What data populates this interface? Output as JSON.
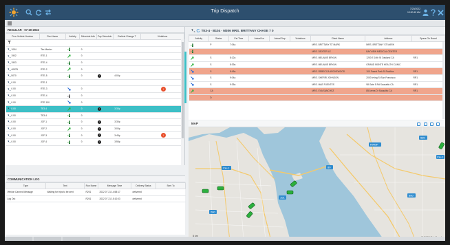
{
  "app": {
    "title": "Trip Dispatch",
    "date": "7/20/2022",
    "time": "10:30:45 AM"
  },
  "left_panel": {
    "header": "REGULAR - 07-20-2022",
    "columns": [
      "Prov Vehicle Number",
      "Run Name",
      "Activity",
      "Schedule Adh",
      "Pay Schedule",
      "Earliest Change T",
      "Violations"
    ],
    "rows": [
      {
        "vehicle": "1094",
        "run": "Tim Marlon",
        "icon": "green-person-in",
        "adh": "0",
        "pay": "",
        "earliest": "",
        "violation": false
      },
      {
        "vehicle": "1902",
        "run": "RTE-1",
        "icon": "green-arrow",
        "adh": "0",
        "pay": "",
        "earliest": "",
        "violation": false
      },
      {
        "vehicle": "1903",
        "run": "RTE-4",
        "icon": "green-person-in",
        "adh": "0",
        "pay": "",
        "earliest": "",
        "violation": false
      },
      {
        "vehicle": "4097B",
        "run": "RTE-2",
        "icon": "green-arrow",
        "adh": "0",
        "pay": "",
        "earliest": "",
        "violation": false
      },
      {
        "vehicle": "5070",
        "run": "RTE-5",
        "icon": "green-person-in",
        "adh": "0",
        "pay": "i",
        "earliest": "4:00p",
        "violation": false
      },
      {
        "vehicle": "0.00",
        "run": "RTE-1",
        "icon": "",
        "adh": "",
        "pay": "",
        "earliest": "",
        "violation": false
      },
      {
        "vehicle": "0.00",
        "run": "RTE-3",
        "icon": "blue-arrow",
        "adh": "0",
        "pay": "",
        "earliest": "",
        "violation": true
      },
      {
        "vehicle": "0.00",
        "run": "RTE-4",
        "icon": "grey-person-out",
        "adh": "0",
        "pay": "",
        "earliest": "",
        "violation": false
      },
      {
        "vehicle": "0.00",
        "run": "RTE 100",
        "icon": "blue-arrow",
        "adh": "0",
        "pay": "",
        "earliest": "",
        "violation": false
      },
      {
        "vehicle": "0.00",
        "run": "TE3-4",
        "icon": "green-arrow",
        "adh": "0",
        "pay": "i",
        "earliest": "3:30p",
        "violation": false,
        "selected": true
      },
      {
        "vehicle": "0.00",
        "run": "TE3-4",
        "icon": "green-person-in",
        "adh": "0",
        "pay": "",
        "earliest": "",
        "violation": false
      },
      {
        "vehicle": "0.00",
        "run": "JCF-1",
        "icon": "green-person-in",
        "adh": "0",
        "pay": "i",
        "earliest": "3:30p",
        "violation": false
      },
      {
        "vehicle": "0.00",
        "run": "JCF-2",
        "icon": "green-arrow",
        "adh": "0",
        "pay": "i",
        "earliest": "3:00p",
        "violation": false
      },
      {
        "vehicle": "0.00",
        "run": "JCF-3",
        "icon": "green-person-in",
        "adh": "0",
        "pay": "i",
        "earliest": "3:45p",
        "violation": true
      },
      {
        "vehicle": "0.00",
        "run": "JCF-4",
        "icon": "green-person-in",
        "adh": "0",
        "pay": "i",
        "earliest": "3:55p",
        "violation": false
      }
    ]
  },
  "comm_log": {
    "header": "COMMUNICATION LOG",
    "columns": [
      "Type",
      "Text",
      "Run Name",
      "Message Time",
      "Delivery Status",
      "Sent To"
    ],
    "rows": [
      {
        "type": "Vehicle Canned Message",
        "text": "Waiting for trips to be sent",
        "run": "R201",
        "time": "2022 07 21 14:58:17",
        "status": "delivered"
      },
      {
        "type": "Log Out",
        "text": "",
        "run": "R201",
        "time": "2022 07 21 15:10:03",
        "status": "delivered"
      }
    ]
  },
  "trip_panel": {
    "header": "TE3-4 · B104 · M306   MRS. BRITTANY CHASE   7   0",
    "columns": [
      "Activity",
      "Status",
      "Est Time",
      "Actual Arr",
      "Actual Dep",
      "Violations",
      "Client Name",
      "Address",
      "Space On Board"
    ],
    "rows": [
      {
        "icon": "green-person-in",
        "status": "P",
        "est": "7:04a",
        "client": "MRS. BRITTANY ST MARK",
        "address": "MRS. BRITTANY ST MARK",
        "space": "",
        "salmon": false
      },
      {
        "icon": "green-person-in",
        "status": "",
        "est": "",
        "client": "MRS. DEXTER LE",
        "address": "BAYVIEW MEDICAL CENTER",
        "space": "",
        "salmon": true
      },
      {
        "icon": "green-arrow",
        "status": "S",
        "est": "8:12a",
        "client": "MRS. MELANIE BRYAN",
        "address": "1200 E 10th St Oakland CA",
        "space": "RR1",
        "salmon": false
      },
      {
        "icon": "green-arrow",
        "status": "S",
        "est": "8:39a",
        "client": "MRS. MELANIE BRYAN",
        "address": "GRAND MONTE HEALTH CLINIC",
        "space": "",
        "salmon": false
      },
      {
        "icon": "blue-arrow",
        "status": "S",
        "est": "8:45a",
        "client": "MRS. REBECCA ARCHEWOOD",
        "address": "100 Forest Park St Pacifica",
        "space": "RR1",
        "salmon": true
      },
      {
        "icon": "blue-arrow",
        "status": "S",
        "est": "9:04a",
        "client": "MRS. SHERRI JOHNSON",
        "address": "2000 Irving St San Francisco",
        "space": "RR1",
        "salmon": false
      },
      {
        "icon": "blue-arrow",
        "status": "S",
        "est": "9:35a",
        "client": "MRS. MAE FUENTES",
        "address": "98 Gate 5 Rd Sausalito CA",
        "space": "RR1",
        "salmon": false
      },
      {
        "icon": "green-arrow",
        "status": "CA",
        "est": "",
        "client": "MRS. EVA SANCHEZ",
        "address": "85 Arena Dr Sausalito CA",
        "space": "RR1",
        "salmon": true
      },
      {
        "icon": "",
        "status": "D",
        "est": "",
        "client": "",
        "address": "",
        "space": "",
        "salmon": true
      }
    ]
  },
  "map": {
    "header": "MAP",
    "copyright": "© 2022 TripSpark",
    "scale": "5 km",
    "road_labels": [
      "CA-1",
      "280",
      "101",
      "80",
      "580",
      "880",
      "RAMP",
      "CA-1"
    ]
  },
  "colors": {
    "topbar": "#2d4f6e",
    "selected_row": "#3dbfc6",
    "salmon_row": "#f0a58c",
    "water": "#9fc6db",
    "land": "#e6e4df",
    "vehicle": "#2bb03d",
    "violation": "#e8522f"
  }
}
